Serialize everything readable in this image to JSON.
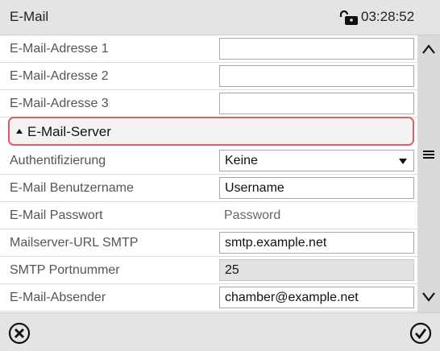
{
  "header": {
    "title": "E-Mail",
    "time": "03:28:52"
  },
  "rows": [
    {
      "label": "E-Mail-Adresse 1",
      "value": ""
    },
    {
      "label": "E-Mail-Adresse 2",
      "value": ""
    },
    {
      "label": "E-Mail-Adresse 3",
      "value": ""
    }
  ],
  "section": {
    "label": "E-Mail-Server",
    "expanded": true
  },
  "server_rows": [
    {
      "label": "Authentifizierung",
      "value": "Keine"
    },
    {
      "label": "E-Mail Benutzername",
      "value": "Username"
    },
    {
      "label": "E-Mail Passwort",
      "value": "Password"
    },
    {
      "label": "Mailserver-URL SMTP",
      "value": "smtp.example.net"
    },
    {
      "label": "SMTP Portnummer",
      "value": "25"
    },
    {
      "label": "E-Mail-Absender",
      "value": "chamber@example.net"
    }
  ],
  "colors": {
    "section_highlight": "#e05b6a",
    "titlebar": "#e4e4e4",
    "scrollbar": "#dadada",
    "readonly_field": "#e2e2e2"
  },
  "icons": {
    "lock": "lock-open-icon",
    "scroll_up": "chevron-up-icon",
    "scroll_handle": "hamburger-icon",
    "scroll_down": "chevron-down-icon",
    "cancel": "cancel-icon",
    "confirm": "checkmark-icon"
  }
}
